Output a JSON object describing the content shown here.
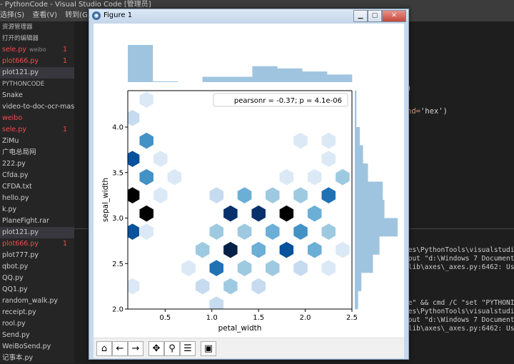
{
  "vscode": {
    "title": "- PythonCode - Visual Studio Code [管理员]",
    "menu": [
      "选择(S)",
      "查看(V)",
      "转到(G"
    ],
    "sidebar": {
      "explorer_header": "资源管理器",
      "open_editors_header": "打开的编辑器",
      "open_editors": [
        {
          "name": "sele.py",
          "note": "weibo",
          "badge": "1",
          "red": true
        },
        {
          "name": "plot666.py",
          "badge": "1",
          "red": true
        },
        {
          "name": "plot121.py",
          "badge": "",
          "red": false
        }
      ],
      "folder_header": "PYTHONCODE",
      "files": [
        {
          "name": "Snake",
          "badge": "",
          "red": false
        },
        {
          "name": "video-to-doc-ocr-mas...",
          "badge": "",
          "red": false
        },
        {
          "name": "weibo",
          "badge": "",
          "red": true
        },
        {
          "name": "sele.py",
          "badge": "1",
          "red": true
        },
        {
          "name": "ZiMu",
          "badge": "",
          "red": false
        },
        {
          "name": "广电总局网",
          "badge": "",
          "red": false
        },
        {
          "name": "222.py",
          "badge": "",
          "red": false
        },
        {
          "name": "Cfda.py",
          "badge": "",
          "red": false
        },
        {
          "name": "CFDA.txt",
          "badge": "",
          "red": false
        },
        {
          "name": "hello.py",
          "badge": "",
          "red": false
        },
        {
          "name": "k.py",
          "badge": "",
          "red": false
        },
        {
          "name": "PlaneFight.rar",
          "badge": "",
          "red": false
        },
        {
          "name": "plot121.py",
          "badge": "",
          "red": false
        },
        {
          "name": "plot666.py",
          "badge": "1",
          "red": true
        },
        {
          "name": "plot777.py",
          "badge": "",
          "red": false
        },
        {
          "name": "qbot.py",
          "badge": "",
          "red": false
        },
        {
          "name": "QQ.py",
          "badge": "",
          "red": false
        },
        {
          "name": "QQ1.py",
          "badge": "",
          "red": false
        },
        {
          "name": "random_walk.py",
          "badge": "",
          "red": false
        },
        {
          "name": "receipt.py",
          "badge": "",
          "red": false
        },
        {
          "name": "rool.py",
          "badge": "",
          "red": false
        },
        {
          "name": "Send.py",
          "badge": "",
          "red": false
        },
        {
          "name": "WeiBoSend.py",
          "badge": "",
          "red": false
        },
        {
          "name": "记事本.py",
          "badge": "",
          "red": false
        }
      ]
    },
    "editor_fragments": {
      "line1": ")",
      "line2_kw": "nd=",
      "line2_val": "'hex')"
    },
    "terminal_lines": [
      "les\\PythonTools\\visualstudio_",
      "tput \"d:\\Windows 7 Documents\\",
      "tlib\\axes\\_axes.py:6462: User",
      "de\" && cmd /C \"set \"PYTHONIO",
      "les\\PythonTools\\visualstudio_",
      "tput \"d:\\Windows 7 Documents\\",
      "tlib\\axes\\_axes.py:6462: User"
    ]
  },
  "figure": {
    "title": "Figure 1",
    "buttons": {
      "minimize": "▁",
      "maximize": "▢",
      "close": "✕"
    },
    "toolbar": [
      "home",
      "back",
      "forward",
      "pan",
      "zoom",
      "configure",
      "save"
    ]
  },
  "chart_data": {
    "type": "hexbin",
    "xlabel": "petal_width",
    "ylabel": "sepal_width",
    "xlim": [
      0.1,
      2.5
    ],
    "ylim": [
      2.0,
      4.4
    ],
    "xticks": [
      "0.5",
      "1.0",
      "1.5",
      "2.0",
      "2.5"
    ],
    "yticks": [
      "2.0",
      "2.5",
      "3.0",
      "3.5",
      "4.0"
    ],
    "annotation": "pearsonr = -0.37; p = 4.1e-06",
    "color": "#1f77b4",
    "hexbins": [
      {
        "x": 0.3,
        "y": 4.3,
        "count": 1
      },
      {
        "x": 0.15,
        "y": 4.1,
        "count": 2
      },
      {
        "x": 0.3,
        "y": 3.85,
        "count": 5
      },
      {
        "x": 0.15,
        "y": 3.65,
        "count": 7
      },
      {
        "x": 0.45,
        "y": 3.65,
        "count": 1
      },
      {
        "x": 0.3,
        "y": 3.45,
        "count": 5
      },
      {
        "x": 0.6,
        "y": 3.45,
        "count": 1
      },
      {
        "x": 0.15,
        "y": 3.25,
        "count": 10
      },
      {
        "x": 0.45,
        "y": 3.25,
        "count": 1
      },
      {
        "x": 0.3,
        "y": 3.05,
        "count": 10
      },
      {
        "x": 0.15,
        "y": 2.85,
        "count": 7
      },
      {
        "x": 0.3,
        "y": 2.85,
        "count": 1
      },
      {
        "x": 0.15,
        "y": 2.25,
        "count": 1
      },
      {
        "x": 1.05,
        "y": 2.05,
        "count": 2
      },
      {
        "x": 0.9,
        "y": 2.25,
        "count": 2
      },
      {
        "x": 1.2,
        "y": 2.25,
        "count": 3
      },
      {
        "x": 1.5,
        "y": 2.25,
        "count": 2
      },
      {
        "x": 0.75,
        "y": 2.45,
        "count": 1
      },
      {
        "x": 1.05,
        "y": 2.45,
        "count": 6
      },
      {
        "x": 1.35,
        "y": 2.45,
        "count": 3
      },
      {
        "x": 1.65,
        "y": 2.45,
        "count": 3
      },
      {
        "x": 1.95,
        "y": 2.45,
        "count": 2
      },
      {
        "x": 2.25,
        "y": 2.45,
        "count": 1
      },
      {
        "x": 0.9,
        "y": 2.65,
        "count": 3
      },
      {
        "x": 1.2,
        "y": 2.65,
        "count": 9
      },
      {
        "x": 1.5,
        "y": 2.65,
        "count": 4
      },
      {
        "x": 1.8,
        "y": 2.65,
        "count": 7
      },
      {
        "x": 2.1,
        "y": 2.65,
        "count": 4
      },
      {
        "x": 2.4,
        "y": 2.65,
        "count": 1
      },
      {
        "x": 1.05,
        "y": 2.85,
        "count": 3
      },
      {
        "x": 1.35,
        "y": 2.85,
        "count": 3
      },
      {
        "x": 1.65,
        "y": 2.85,
        "count": 4
      },
      {
        "x": 1.95,
        "y": 2.85,
        "count": 5
      },
      {
        "x": 2.25,
        "y": 2.85,
        "count": 3
      },
      {
        "x": 1.2,
        "y": 3.05,
        "count": 8
      },
      {
        "x": 1.5,
        "y": 3.05,
        "count": 8
      },
      {
        "x": 1.8,
        "y": 3.05,
        "count": 10
      },
      {
        "x": 2.1,
        "y": 3.05,
        "count": 4
      },
      {
        "x": 1.05,
        "y": 3.25,
        "count": 2
      },
      {
        "x": 1.35,
        "y": 3.25,
        "count": 4
      },
      {
        "x": 1.65,
        "y": 3.25,
        "count": 3
      },
      {
        "x": 1.95,
        "y": 3.25,
        "count": 3
      },
      {
        "x": 2.25,
        "y": 3.25,
        "count": 6
      },
      {
        "x": 1.8,
        "y": 3.45,
        "count": 1
      },
      {
        "x": 2.1,
        "y": 3.45,
        "count": 1
      },
      {
        "x": 2.4,
        "y": 3.45,
        "count": 3
      },
      {
        "x": 2.25,
        "y": 3.65,
        "count": 1
      },
      {
        "x": 1.95,
        "y": 3.85,
        "count": 1
      },
      {
        "x": 2.25,
        "y": 3.85,
        "count": 1
      }
    ],
    "marginal_x_counts": [
      49,
      1,
      0,
      7,
      7,
      21,
      18,
      14,
      10
    ],
    "marginal_y_counts": [
      2,
      4,
      11,
      15,
      26,
      18,
      17,
      8,
      5,
      3,
      1,
      1
    ]
  }
}
